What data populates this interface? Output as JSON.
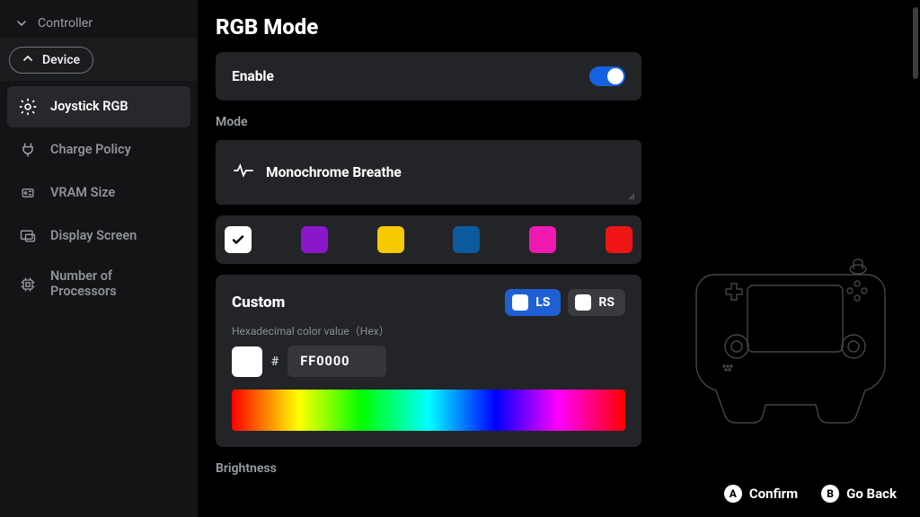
{
  "sidebar": {
    "collapsed_section": "Controller",
    "expanded_section": "Device",
    "items": [
      {
        "label": "Joystick RGB",
        "icon": "gear-icon",
        "active": true
      },
      {
        "label": "Charge Policy",
        "icon": "plug-icon",
        "active": false
      },
      {
        "label": "VRAM Size",
        "icon": "chip-icon",
        "active": false
      },
      {
        "label": "Display Screen",
        "icon": "monitor-icon",
        "active": false
      },
      {
        "label": "Number of Processors",
        "icon": "cpu-icon",
        "active": false
      }
    ]
  },
  "page": {
    "title": "RGB Mode",
    "enable_label": "Enable",
    "enable_value": true,
    "mode_section_label": "Mode",
    "mode_selected": "Monochrome Breathe",
    "swatches": [
      {
        "color": "#ffffff",
        "selected": true
      },
      {
        "color": "#8a17c9",
        "selected": false
      },
      {
        "color": "#f6c900",
        "selected": false
      },
      {
        "color": "#0b5a9c",
        "selected": false
      },
      {
        "color": "#ef19b1",
        "selected": false
      },
      {
        "color": "#ef1515",
        "selected": false
      }
    ],
    "custom": {
      "title": "Custom",
      "hint": "Hexadecimal color value（Hex）",
      "ls_label": "LS",
      "rs_label": "RS",
      "active_stick": "LS",
      "hash": "#",
      "hex_value": "FF0000"
    },
    "brightness_label": "Brightness"
  },
  "footer": {
    "confirm_key": "A",
    "confirm_label": "Confirm",
    "back_key": "B",
    "back_label": "Go Back"
  }
}
